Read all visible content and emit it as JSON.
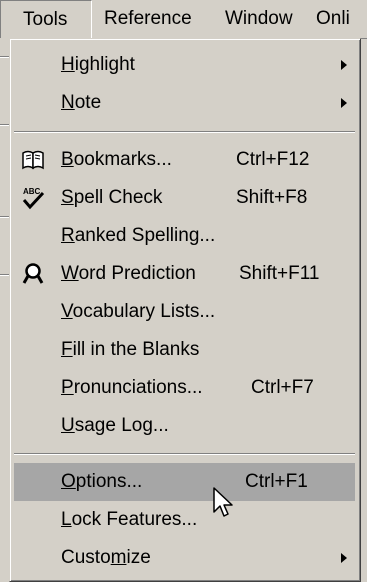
{
  "menubar": {
    "items": [
      {
        "label": "Tools",
        "state": "open"
      },
      {
        "label": "Reference"
      },
      {
        "label": "Window"
      },
      {
        "label": "Onli"
      }
    ]
  },
  "menu": {
    "items": [
      {
        "pre": "",
        "key": "H",
        "post": "ighlight",
        "shortcut": "",
        "submenu": true
      },
      {
        "pre": "",
        "key": "N",
        "post": "ote",
        "shortcut": "",
        "submenu": true
      },
      {
        "pre": "",
        "key": "B",
        "post": "ookmarks...",
        "shortcut": "Ctrl+F12",
        "icon": "book-icon"
      },
      {
        "pre": "",
        "key": "S",
        "post": "pell Check",
        "shortcut": "Shift+F8",
        "icon": "spell-check-icon"
      },
      {
        "pre": "",
        "key": "R",
        "post": "anked Spelling...",
        "shortcut": ""
      },
      {
        "pre": "",
        "key": "W",
        "post": "ord Prediction",
        "shortcut": "Shift+F11",
        "icon": "magnifier-icon"
      },
      {
        "pre": "",
        "key": "V",
        "post": "ocabulary Lists...",
        "shortcut": ""
      },
      {
        "pre": "",
        "key": "F",
        "post": "ill in the Blanks",
        "shortcut": ""
      },
      {
        "pre": "",
        "key": "P",
        "post": "ronunciations...",
        "shortcut": "Ctrl+F7"
      },
      {
        "pre": "",
        "key": "U",
        "post": "sage Log...",
        "shortcut": ""
      },
      {
        "pre": "",
        "key": "O",
        "post": "ptions...",
        "shortcut": "Ctrl+F1",
        "highlighted": true
      },
      {
        "pre": "",
        "key": "L",
        "post": "ock Features...",
        "shortcut": ""
      },
      {
        "pre": "Custo",
        "key": "m",
        "post": "ize",
        "shortcut": "",
        "submenu": true
      }
    ]
  },
  "colors": {
    "menu_bg": "#d4d0c8",
    "highlight": "#a6a6a6",
    "text": "#000000"
  }
}
